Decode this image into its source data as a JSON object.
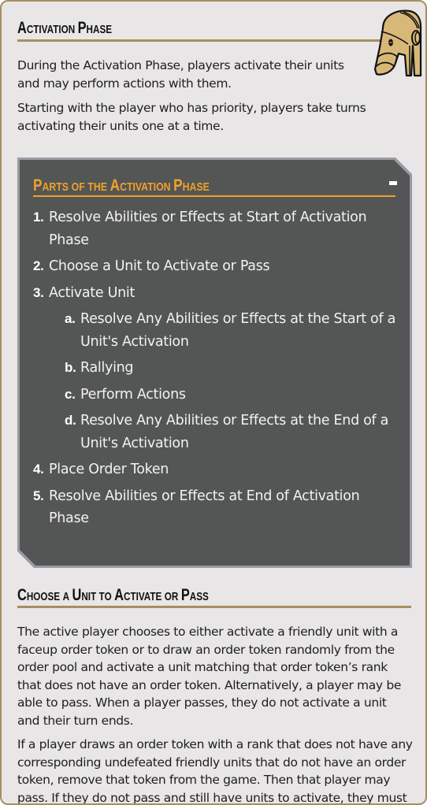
{
  "section1": {
    "title_parts": [
      {
        "cap": "A",
        "rest": "ctivation"
      },
      {
        "cap": "P",
        "rest": "hase"
      }
    ],
    "paragraphs": [
      "During the Activation Phase, players activate their units and may perform actions with them.",
      "Starting with the player who has priority, players take turns activating their units one at a time."
    ],
    "icon": "battle-droid-head-icon"
  },
  "phase_box": {
    "title_parts": [
      {
        "cap": "P",
        "rest": "arts"
      },
      {
        "cap": "",
        "rest": "of"
      },
      {
        "cap": "",
        "rest": "the"
      },
      {
        "cap": "A",
        "rest": "ctivation"
      },
      {
        "cap": "P",
        "rest": "hase"
      }
    ],
    "collapse_label": "-",
    "accent_color": "#f0a22a",
    "background_color": "#545555",
    "steps": [
      {
        "num": "1.",
        "text": "Resolve Abilities or Effects at Start of Activation Phase"
      },
      {
        "num": "2.",
        "text": "Choose a Unit to Activate or Pass"
      },
      {
        "num": "3.",
        "text": "Activate Unit",
        "substeps": [
          {
            "num": "a.",
            "text": "Resolve Any Abilities or Effects at the Start of a Unit's Activation"
          },
          {
            "num": "b.",
            "text": "Rallying"
          },
          {
            "num": "c.",
            "text": "Perform Actions"
          },
          {
            "num": "d.",
            "text": "Resolve Any Abilities or Effects at the End of a Unit's Activation"
          }
        ]
      },
      {
        "num": "4.",
        "text": "Place Order Token"
      },
      {
        "num": "5.",
        "text": "Resolve Abilities or Effects at End of Activation Phase"
      }
    ]
  },
  "section2": {
    "title_parts": [
      {
        "cap": "C",
        "rest": "hoose"
      },
      {
        "cap": "",
        "rest": "a"
      },
      {
        "cap": "U",
        "rest": "nit"
      },
      {
        "cap": "",
        "rest": "to"
      },
      {
        "cap": "A",
        "rest": "ctivate"
      },
      {
        "cap": "",
        "rest": "or"
      },
      {
        "cap": "P",
        "rest": "ass"
      }
    ],
    "paragraphs": [
      "The active player chooses to either activate a friendly unit with a faceup order token or to draw an order token randomly from the order pool and activate a unit matching that order token’s rank that does not have an order token. Alternatively, a player may be able to pass. When a player passes, they do not activate a unit and their turn ends.",
      "If a player draws an order token with a rank that does not have any corresponding undefeated friendly units that do not have an order token, remove that token from the game. Then that player may pass. If they do not pass and still have units to activate, they must"
    ]
  },
  "colors": {
    "page_bg": "#e8e6e6",
    "border": "#a88e5f",
    "heading": "#111111",
    "body_text": "#1e1e1e"
  }
}
